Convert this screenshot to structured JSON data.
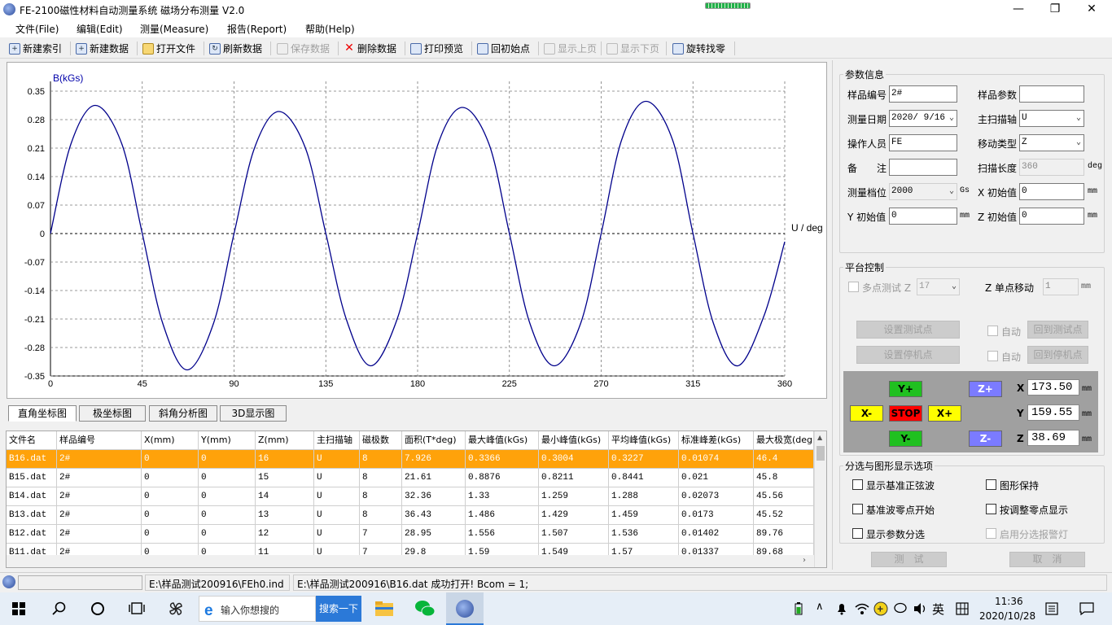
{
  "window": {
    "title": "FE-2100磁性材料自动测量系统 磁场分布测量 V2.0",
    "min": "—",
    "max": "❐",
    "close": "✕"
  },
  "menu": [
    "文件(File)",
    "编辑(Edit)",
    "测量(Measure)",
    "报告(Report)",
    "帮助(Help)"
  ],
  "toolbar": [
    {
      "label": "新建索引",
      "icon": "new-index-icon",
      "enabled": true
    },
    {
      "label": "新建数据",
      "icon": "new-data-icon",
      "enabled": true
    },
    {
      "label": "打开文件",
      "icon": "open-folder-icon",
      "enabled": true
    },
    {
      "label": "刷新数据",
      "icon": "refresh-icon",
      "enabled": true
    },
    {
      "label": "保存数据",
      "icon": "save-icon",
      "enabled": false
    },
    {
      "label": "删除数据",
      "icon": "delete-icon",
      "enabled": true
    },
    {
      "label": "打印预览",
      "icon": "print-icon",
      "enabled": true
    },
    {
      "label": "回初始点",
      "icon": "home-icon",
      "enabled": true
    },
    {
      "label": "显示上页",
      "icon": "prev-page-icon",
      "enabled": false
    },
    {
      "label": "显示下页",
      "icon": "next-page-icon",
      "enabled": false
    },
    {
      "label": "旋转找零",
      "icon": "rotate-zero-icon",
      "enabled": true
    }
  ],
  "chart_data": {
    "type": "line",
    "ylabel": "B(kGs)",
    "xlabel": "U / deg",
    "xlim": [
      0,
      360
    ],
    "ylim": [
      -0.35,
      0.35
    ],
    "xticks": [
      0,
      45,
      90,
      135,
      180,
      225,
      270,
      315,
      360
    ],
    "yticks": [
      0.35,
      0.28,
      0.21,
      0.14,
      0.07,
      0,
      -0.07,
      -0.14,
      -0.21,
      -0.28,
      -0.35
    ],
    "ytick_labels": [
      "0.35",
      "0.28",
      "0.21",
      "0.14",
      "0.07",
      "0",
      "-0.07",
      "-0.14",
      "-0.21",
      "-0.28",
      "-0.35"
    ],
    "grid": true,
    "line_color": "#00008b",
    "x": [
      0,
      10,
      22,
      35,
      45,
      55,
      67,
      80,
      90,
      100,
      112,
      125,
      135,
      145,
      157,
      170,
      180,
      190,
      202,
      215,
      225,
      235,
      247,
      260,
      270,
      280,
      292,
      305,
      315,
      325,
      337,
      350,
      360
    ],
    "y": [
      0,
      0.22,
      0.315,
      0.22,
      0,
      -0.22,
      -0.335,
      -0.22,
      0,
      0.21,
      0.3,
      0.21,
      0,
      -0.21,
      -0.325,
      -0.21,
      0,
      0.22,
      0.31,
      0.22,
      0,
      -0.22,
      -0.325,
      -0.22,
      0,
      0.23,
      0.325,
      0.23,
      0,
      -0.22,
      -0.325,
      -0.2,
      -0.02
    ]
  },
  "view_tabs": [
    "直角坐标图",
    "极坐标图",
    "斜角分析图",
    "3D显示图"
  ],
  "table": {
    "columns": [
      "文件名",
      "样品编号",
      "X(mm)",
      "Y(mm)",
      "Z(mm)",
      "主扫描轴",
      "磁极数",
      "面积(T*deg)",
      "最大峰值(kGs)",
      "最小峰值(kGs)",
      "平均峰值(kGs)",
      "标准峰差(kGs)",
      "最大极宽(deg)"
    ],
    "rows": [
      [
        "B16.dat",
        "2#",
        "0",
        "0",
        "16",
        "U",
        "8",
        "7.926",
        "0.3366",
        "0.3004",
        "0.3227",
        "0.01074",
        "46.4"
      ],
      [
        "B15.dat",
        "2#",
        "0",
        "0",
        "15",
        "U",
        "8",
        "21.61",
        "0.8876",
        "0.8211",
        "0.8441",
        "0.021",
        "45.8"
      ],
      [
        "B14.dat",
        "2#",
        "0",
        "0",
        "14",
        "U",
        "8",
        "32.36",
        "1.33",
        "1.259",
        "1.288",
        "0.02073",
        "45.56"
      ],
      [
        "B13.dat",
        "2#",
        "0",
        "0",
        "13",
        "U",
        "8",
        "36.43",
        "1.486",
        "1.429",
        "1.459",
        "0.0173",
        "45.52"
      ],
      [
        "B12.dat",
        "2#",
        "0",
        "0",
        "12",
        "U",
        "7",
        "28.95",
        "1.556",
        "1.507",
        "1.536",
        "0.01402",
        "89.76"
      ],
      [
        "B11.dat",
        "2#",
        "0",
        "0",
        "11",
        "U",
        "7",
        "29.8",
        "1.59",
        "1.549",
        "1.57",
        "0.01337",
        "89.68"
      ]
    ]
  },
  "params": {
    "group_title": "参数信息",
    "sample_no_label": "样品编号",
    "sample_no": "2#",
    "sample_param_label": "样品参数",
    "sample_param": "",
    "date_label": "测量日期",
    "date": "2020/ 9/16",
    "main_axis_label": "主扫描轴",
    "main_axis": "U",
    "operator_label": "操作人员",
    "operator": "FE",
    "move_type_label": "移动类型",
    "move_type": "Z",
    "note_label": "备　　注",
    "note": "",
    "scan_len_label": "扫描长度",
    "scan_len": "360",
    "scan_len_unit": "deg",
    "range_label": "测量档位",
    "range": "2000",
    "range_unit": "Gs",
    "x_init_label": "X 初始值",
    "x_init": "0",
    "x_unit": "mm",
    "y_init_label": "Y 初始值",
    "y_init": "0",
    "y_unit": "mm",
    "z_init_label": "Z 初始值",
    "z_init": "0",
    "z_unit": "mm"
  },
  "platform": {
    "group_title": "平台控制",
    "multi_label": "多点测试 Z",
    "multi_value": "17",
    "single_move_label": "Z 单点移动",
    "single_move": "1",
    "single_move_unit": "mm",
    "set_test_point": "设置测试点",
    "auto1": "自动",
    "goto_test_point": "回到测试点",
    "set_stop_point": "设置停机点",
    "auto2": "自动",
    "goto_stop_point": "回到停机点",
    "y_plus": "Y+",
    "y_minus": "Y-",
    "x_minus": "X-",
    "x_plus": "X+",
    "stop": "STOP",
    "z_plus": "Z+",
    "z_minus": "Z-",
    "x_label": "X",
    "x_value": "173.50",
    "y_label": "Y",
    "y_value": "159.55",
    "z_label": "Z",
    "z_value": "38.69",
    "coord_unit": "mm"
  },
  "options": {
    "group_title": "分选与图形显示选项",
    "items": [
      "显示基准正弦波",
      "图形保持",
      "基准波零点开始",
      "按调整零点显示",
      "显示参数分选",
      "启用分选报警灯"
    ]
  },
  "actions": {
    "test": "测　试",
    "cancel": "取　消"
  },
  "status": {
    "path1": "E:\\样品测试200916\\FEh0.ind",
    "message": "E:\\样品测试200916\\B16.dat 成功打开! Bcom = 1;"
  },
  "taskbar": {
    "search_placeholder": "输入你想搜的",
    "search_button": "搜索一下",
    "ime": "英",
    "time": "11:36",
    "date": "2020/10/28"
  }
}
